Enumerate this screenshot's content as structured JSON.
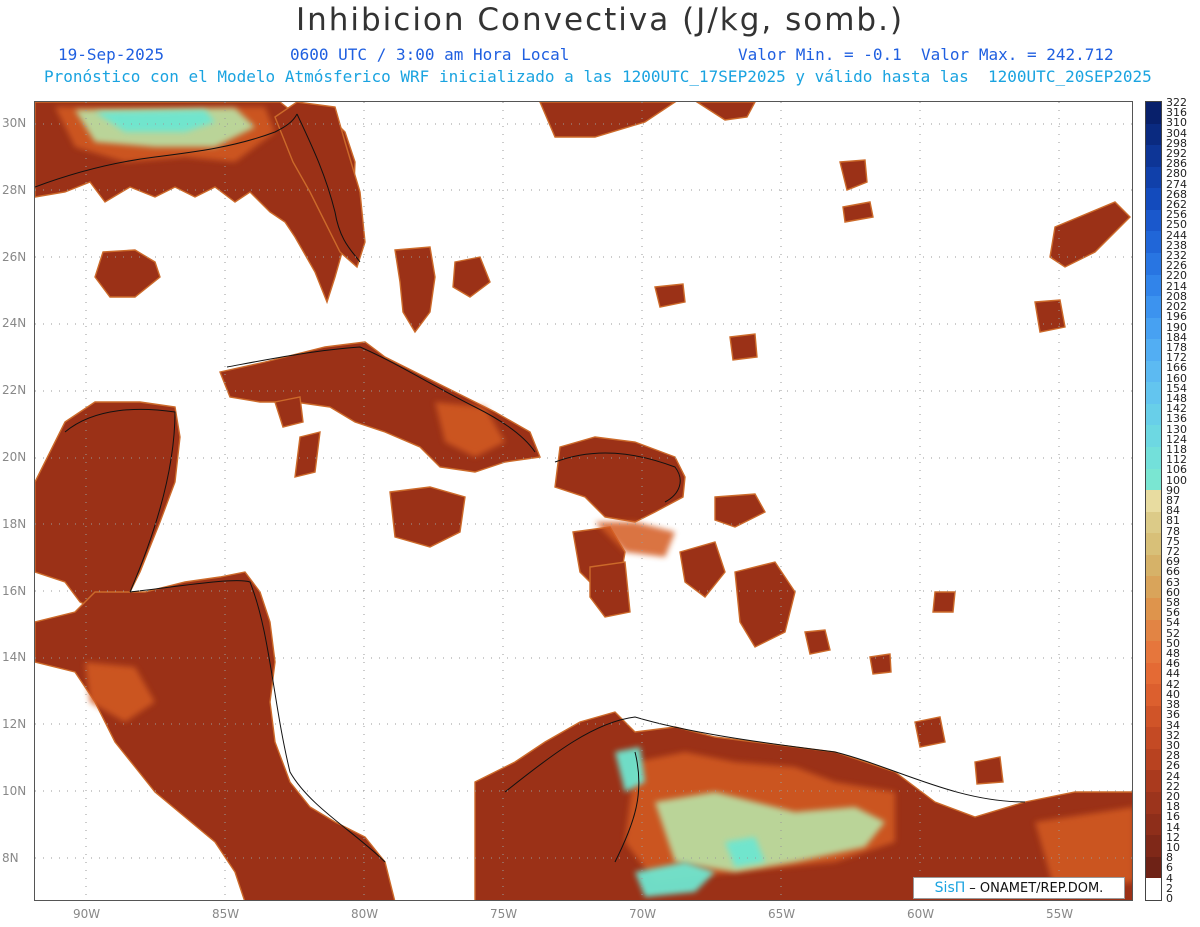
{
  "header": {
    "title": "Inhibicion Convectiva (J/kg, somb.)",
    "date": "19-Sep-2025",
    "time": "0600 UTC / 3:00 am Hora Local",
    "min_max": "Valor Min. = -0.1  Valor Max. = 242.712",
    "subtitle": "Pronóstico con el Modelo Atmósferico WRF inicializado a las 1200UTC_17SEP2025 y válido hasta las  1200UTC_20SEP2025"
  },
  "map": {
    "lat_labels": [
      "30N",
      "28N",
      "26N",
      "24N",
      "22N",
      "20N",
      "18N",
      "16N",
      "14N",
      "12N",
      "10N",
      "8N"
    ],
    "lon_labels": [
      "90W",
      "85W",
      "80W",
      "75W",
      "70W",
      "65W",
      "60W",
      "55W"
    ],
    "land_color": "#8b2d16",
    "field_colors": [
      "#9c3218",
      "#b8441c",
      "#d25d22",
      "#e38b45",
      "#b9e2a6",
      "#6ee6d0",
      "#2fb9e6"
    ]
  },
  "colorbar": {
    "labels": [
      "322",
      "316",
      "310",
      "304",
      "298",
      "292",
      "286",
      "280",
      "274",
      "268",
      "262",
      "256",
      "250",
      "244",
      "238",
      "232",
      "226",
      "220",
      "214",
      "208",
      "202",
      "196",
      "190",
      "184",
      "178",
      "172",
      "166",
      "160",
      "154",
      "148",
      "142",
      "136",
      "130",
      "124",
      "118",
      "112",
      "106",
      "100",
      "90",
      "87",
      "84",
      "81",
      "78",
      "75",
      "72",
      "69",
      "66",
      "63",
      "60",
      "58",
      "56",
      "54",
      "52",
      "50",
      "48",
      "46",
      "44",
      "42",
      "40",
      "38",
      "36",
      "34",
      "32",
      "30",
      "28",
      "26",
      "24",
      "22",
      "20",
      "18",
      "16",
      "14",
      "12",
      "10",
      "8",
      "6",
      "4",
      "2",
      "0"
    ],
    "colors": [
      "#08206b",
      "#0a2a80",
      "#0d3596",
      "#1040aa",
      "#134bbd",
      "#1a58cc",
      "#2066d8",
      "#2875e2",
      "#3184ea",
      "#3c93ef",
      "#47a1f2",
      "#52aef3",
      "#5cbaf2",
      "#63c5ef",
      "#68cfe9",
      "#6dd8e2",
      "#73e0da",
      "#7ae6d2",
      "#e8dca0",
      "#dccb88",
      "#d8c078",
      "#d6b268",
      "#d9a45a",
      "#de944c",
      "#e28444",
      "#e6763c",
      "#e46a34",
      "#dc5f2e",
      "#d05428",
      "#c44a24",
      "#b84220",
      "#aa3a1e",
      "#9c341c",
      "#8e2e1a",
      "#7f2818",
      "#6e2216",
      "#ffffff"
    ]
  },
  "credit": {
    "brand": "SisΠ",
    "text": "– ONAMET/REP.DOM."
  }
}
